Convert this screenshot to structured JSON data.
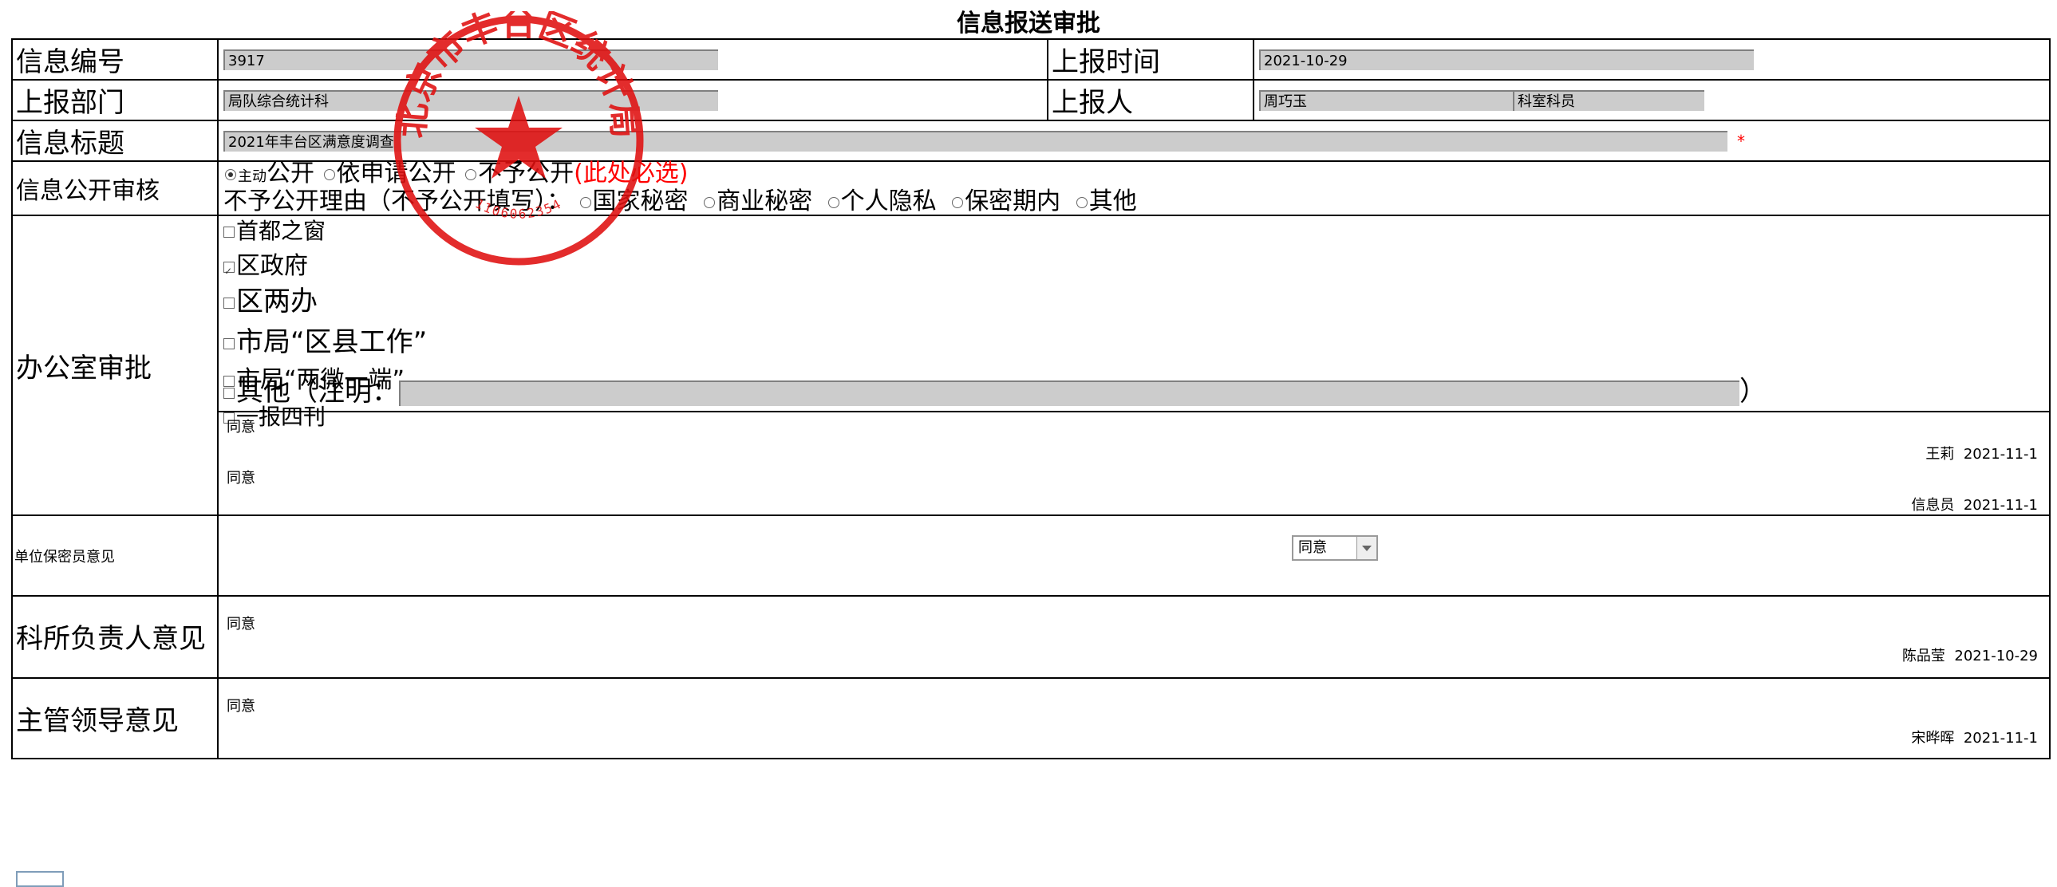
{
  "page_title": "信息报送审批",
  "info_no": {
    "label": "信息编号",
    "value": "3917"
  },
  "report_time": {
    "label": "上报时间",
    "value": "2021-10-29"
  },
  "report_dept": {
    "label": "上报部门",
    "value": "局队综合统计科"
  },
  "reporter": {
    "label": "上报人",
    "name": "周巧玉",
    "position": "科室科员"
  },
  "info_title": {
    "label": "信息标题",
    "value": "2021年丰台区满意度调查",
    "required_mark": "*"
  },
  "disclosure": {
    "label": "信息公开审核",
    "options": [
      {
        "label": "主动",
        "label_suffix": "公开",
        "selected": true
      },
      {
        "label": "依申请公开",
        "selected": false
      },
      {
        "label": "不予公开",
        "selected": false
      }
    ],
    "must_choose_note": "(此处必选)",
    "reason_label": "不予公开理由（不予公开填写）：",
    "reasons": [
      "国家秘密",
      "商业秘密",
      "个人隐私",
      "保密期内",
      "其他"
    ]
  },
  "office_approval": {
    "label": "办公室审批",
    "channels": [
      {
        "label": "首都之窗",
        "checked": false
      },
      {
        "label": "区政府",
        "checked": true
      },
      {
        "label": "区两办",
        "checked": false
      },
      {
        "label": "市局“区县工作”",
        "checked": false
      },
      {
        "label": "市局“两微一端”",
        "checked": false
      },
      {
        "label": "一报四刊",
        "checked": false
      }
    ],
    "other_label": "其他（注明：",
    "other_close": "）",
    "opinions": [
      {
        "text": "同意",
        "signer": "王莉",
        "date": "2021-11-1"
      },
      {
        "text": "同意",
        "signer": "信息员",
        "date": "2021-11-1"
      }
    ]
  },
  "security_officer": {
    "label": "单位保密员意见",
    "selected": "同意"
  },
  "section_head": {
    "label": "科所负责人意见",
    "text": "同意",
    "signer": "陈品莹",
    "date": "2021-10-29"
  },
  "leader": {
    "label": "主管领导意见",
    "text": "同意",
    "signer": "宋晔晖",
    "date": "2021-11-1"
  },
  "seal": {
    "text": "北京市丰台区统计局",
    "number": "1106062354"
  },
  "colors": {
    "seal": "#e01010",
    "field": "#cccccc",
    "required": "#ff0000"
  }
}
